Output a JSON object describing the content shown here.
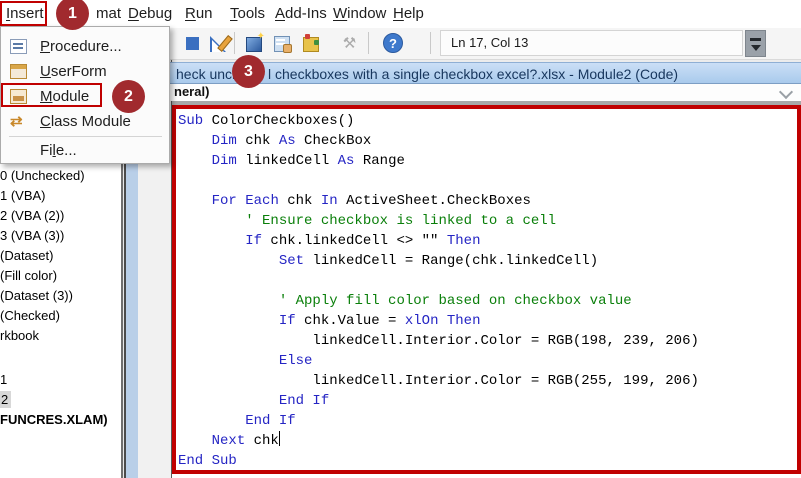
{
  "colors": {
    "annotation_red": "#C00000",
    "badge_red": "#A12A2E",
    "keyword_blue": "#2525C4",
    "comment_green": "#0A7F0A",
    "titlebar_blue": "#B8D3F0"
  },
  "menu_bar": {
    "items": [
      {
        "label": "Insert",
        "u": 0,
        "boxed": true
      },
      {
        "label": "mat",
        "u": -1
      },
      {
        "label": "Debug",
        "u": 0
      },
      {
        "label": "Run",
        "u": 0
      },
      {
        "label": "Tools",
        "u": 0
      },
      {
        "label": "Add-Ins",
        "u": 0
      },
      {
        "label": "Window",
        "u": 0
      },
      {
        "label": "Help",
        "u": 0
      }
    ]
  },
  "badges": {
    "one": "1",
    "two": "2",
    "three": "3"
  },
  "insert_menu": {
    "items": [
      {
        "label": "Procedure...",
        "u": 0,
        "icon": "procedure-icon"
      },
      {
        "label": "UserForm",
        "u": 0,
        "icon": "userform-icon"
      },
      {
        "label": "Module",
        "u": 0,
        "icon": "module-icon",
        "boxed": true
      },
      {
        "label": "Class Module",
        "u": 0,
        "icon": "class-module-icon"
      },
      {
        "label": "File...",
        "u": 2,
        "icon": null
      }
    ]
  },
  "toolbar": {
    "position_indicator": "Ln 17, Col 13",
    "icons": [
      "pause-icon",
      "stop-icon",
      "design-mode-icon",
      "project-explorer-icon",
      "properties-window-icon",
      "object-browser-icon",
      "toolbox-icon",
      "help-icon"
    ]
  },
  "code_window": {
    "title_before": "heck unche",
    "title_after": "l checkboxes with a single checkbox excel?.xlsx - Module2 (Code)",
    "combo_text": "neral)"
  },
  "project_tree": {
    "items": [
      {
        "label": "0 (Unchecked)"
      },
      {
        "label": "1 (VBA)"
      },
      {
        "label": "2 (VBA (2))"
      },
      {
        "label": "3 (VBA (3))"
      },
      {
        "label": "(Dataset)"
      },
      {
        "label": "(Fill color)"
      },
      {
        "label": "(Dataset (3))"
      },
      {
        "label": "(Checked)"
      },
      {
        "label": "rkbook"
      },
      {
        "label": "",
        "blank": true
      },
      {
        "label": "1"
      },
      {
        "label": "2",
        "selected": true
      },
      {
        "label": "FUNCRES.XLAM)",
        "bold": true
      }
    ]
  },
  "code": {
    "lines": [
      [
        [
          "k",
          "Sub"
        ],
        [
          "p",
          " ColorCheckboxes()"
        ]
      ],
      [
        [
          "p",
          "    "
        ],
        [
          "k",
          "Dim"
        ],
        [
          "p",
          " chk "
        ],
        [
          "k",
          "As"
        ],
        [
          "p",
          " CheckBox"
        ]
      ],
      [
        [
          "p",
          "    "
        ],
        [
          "k",
          "Dim"
        ],
        [
          "p",
          " linkedCell "
        ],
        [
          "k",
          "As"
        ],
        [
          "p",
          " Range"
        ]
      ],
      [],
      [
        [
          "p",
          "    "
        ],
        [
          "k",
          "For"
        ],
        [
          "p",
          " "
        ],
        [
          "k",
          "Each"
        ],
        [
          "p",
          " chk "
        ],
        [
          "k",
          "In"
        ],
        [
          "p",
          " ActiveSheet.CheckBoxes"
        ]
      ],
      [
        [
          "p",
          "        "
        ],
        [
          "c",
          "' Ensure checkbox is linked to a cell"
        ]
      ],
      [
        [
          "p",
          "        "
        ],
        [
          "k",
          "If"
        ],
        [
          "p",
          " chk.linkedCell <> \"\" "
        ],
        [
          "k",
          "Then"
        ]
      ],
      [
        [
          "p",
          "            "
        ],
        [
          "k",
          "Set"
        ],
        [
          "p",
          " linkedCell = Range(chk.linkedCell)"
        ]
      ],
      [],
      [
        [
          "p",
          "            "
        ],
        [
          "c",
          "' Apply fill color based on checkbox value"
        ]
      ],
      [
        [
          "p",
          "            "
        ],
        [
          "k",
          "If"
        ],
        [
          "p",
          " chk.Value = "
        ],
        [
          "k",
          "xlOn"
        ],
        [
          "p",
          " "
        ],
        [
          "k",
          "Then"
        ]
      ],
      [
        [
          "p",
          "                linkedCell.Interior.Color = RGB(198, 239, 206)"
        ]
      ],
      [
        [
          "p",
          "            "
        ],
        [
          "k",
          "Else"
        ]
      ],
      [
        [
          "p",
          "                linkedCell.Interior.Color = RGB(255, 199, 206)"
        ]
      ],
      [
        [
          "p",
          "            "
        ],
        [
          "k",
          "End If"
        ]
      ],
      [
        [
          "p",
          "        "
        ],
        [
          "k",
          "End If"
        ]
      ],
      [
        [
          "p",
          "    "
        ],
        [
          "k",
          "Next"
        ],
        [
          "p",
          " chk"
        ],
        [
          "caret",
          ""
        ]
      ],
      [
        [
          "k",
          "End Sub"
        ]
      ]
    ]
  }
}
